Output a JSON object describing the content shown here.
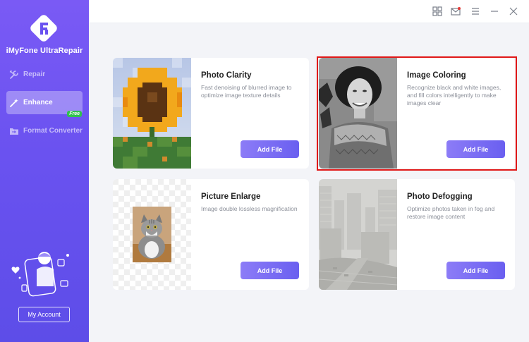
{
  "app": {
    "name": "iMyFone UltraRepair"
  },
  "sidebar": {
    "items": [
      {
        "label": "Repair",
        "icon": "wrench-icon"
      },
      {
        "label": "Enhance",
        "icon": "magic-wand-icon",
        "active": true
      },
      {
        "label": "Format Converter",
        "icon": "folder-icon",
        "badge": "Free"
      }
    ],
    "account_label": "My Account"
  },
  "topbar": {
    "icons": [
      "grid-icon",
      "mail-icon",
      "menu-icon",
      "minimize-icon",
      "close-icon"
    ]
  },
  "cards": [
    {
      "title": "Photo Clarity",
      "description": "Fast denoising of blurred image to optimize image texture details",
      "button": "Add File"
    },
    {
      "title": "Image Coloring",
      "description": "Recognize black and white images, and fill colors intelligently to make images clear",
      "button": "Add File",
      "selected": true
    },
    {
      "title": "Picture Enlarge",
      "description": "Image double lossless magnification",
      "button": "Add File"
    },
    {
      "title": "Photo Defogging",
      "description": "Optimize photos taken in fog and restore image content",
      "button": "Add File"
    }
  ],
  "colors": {
    "accent": "#6a52f0",
    "highlight": "#e01818",
    "badge": "#31c14f"
  }
}
